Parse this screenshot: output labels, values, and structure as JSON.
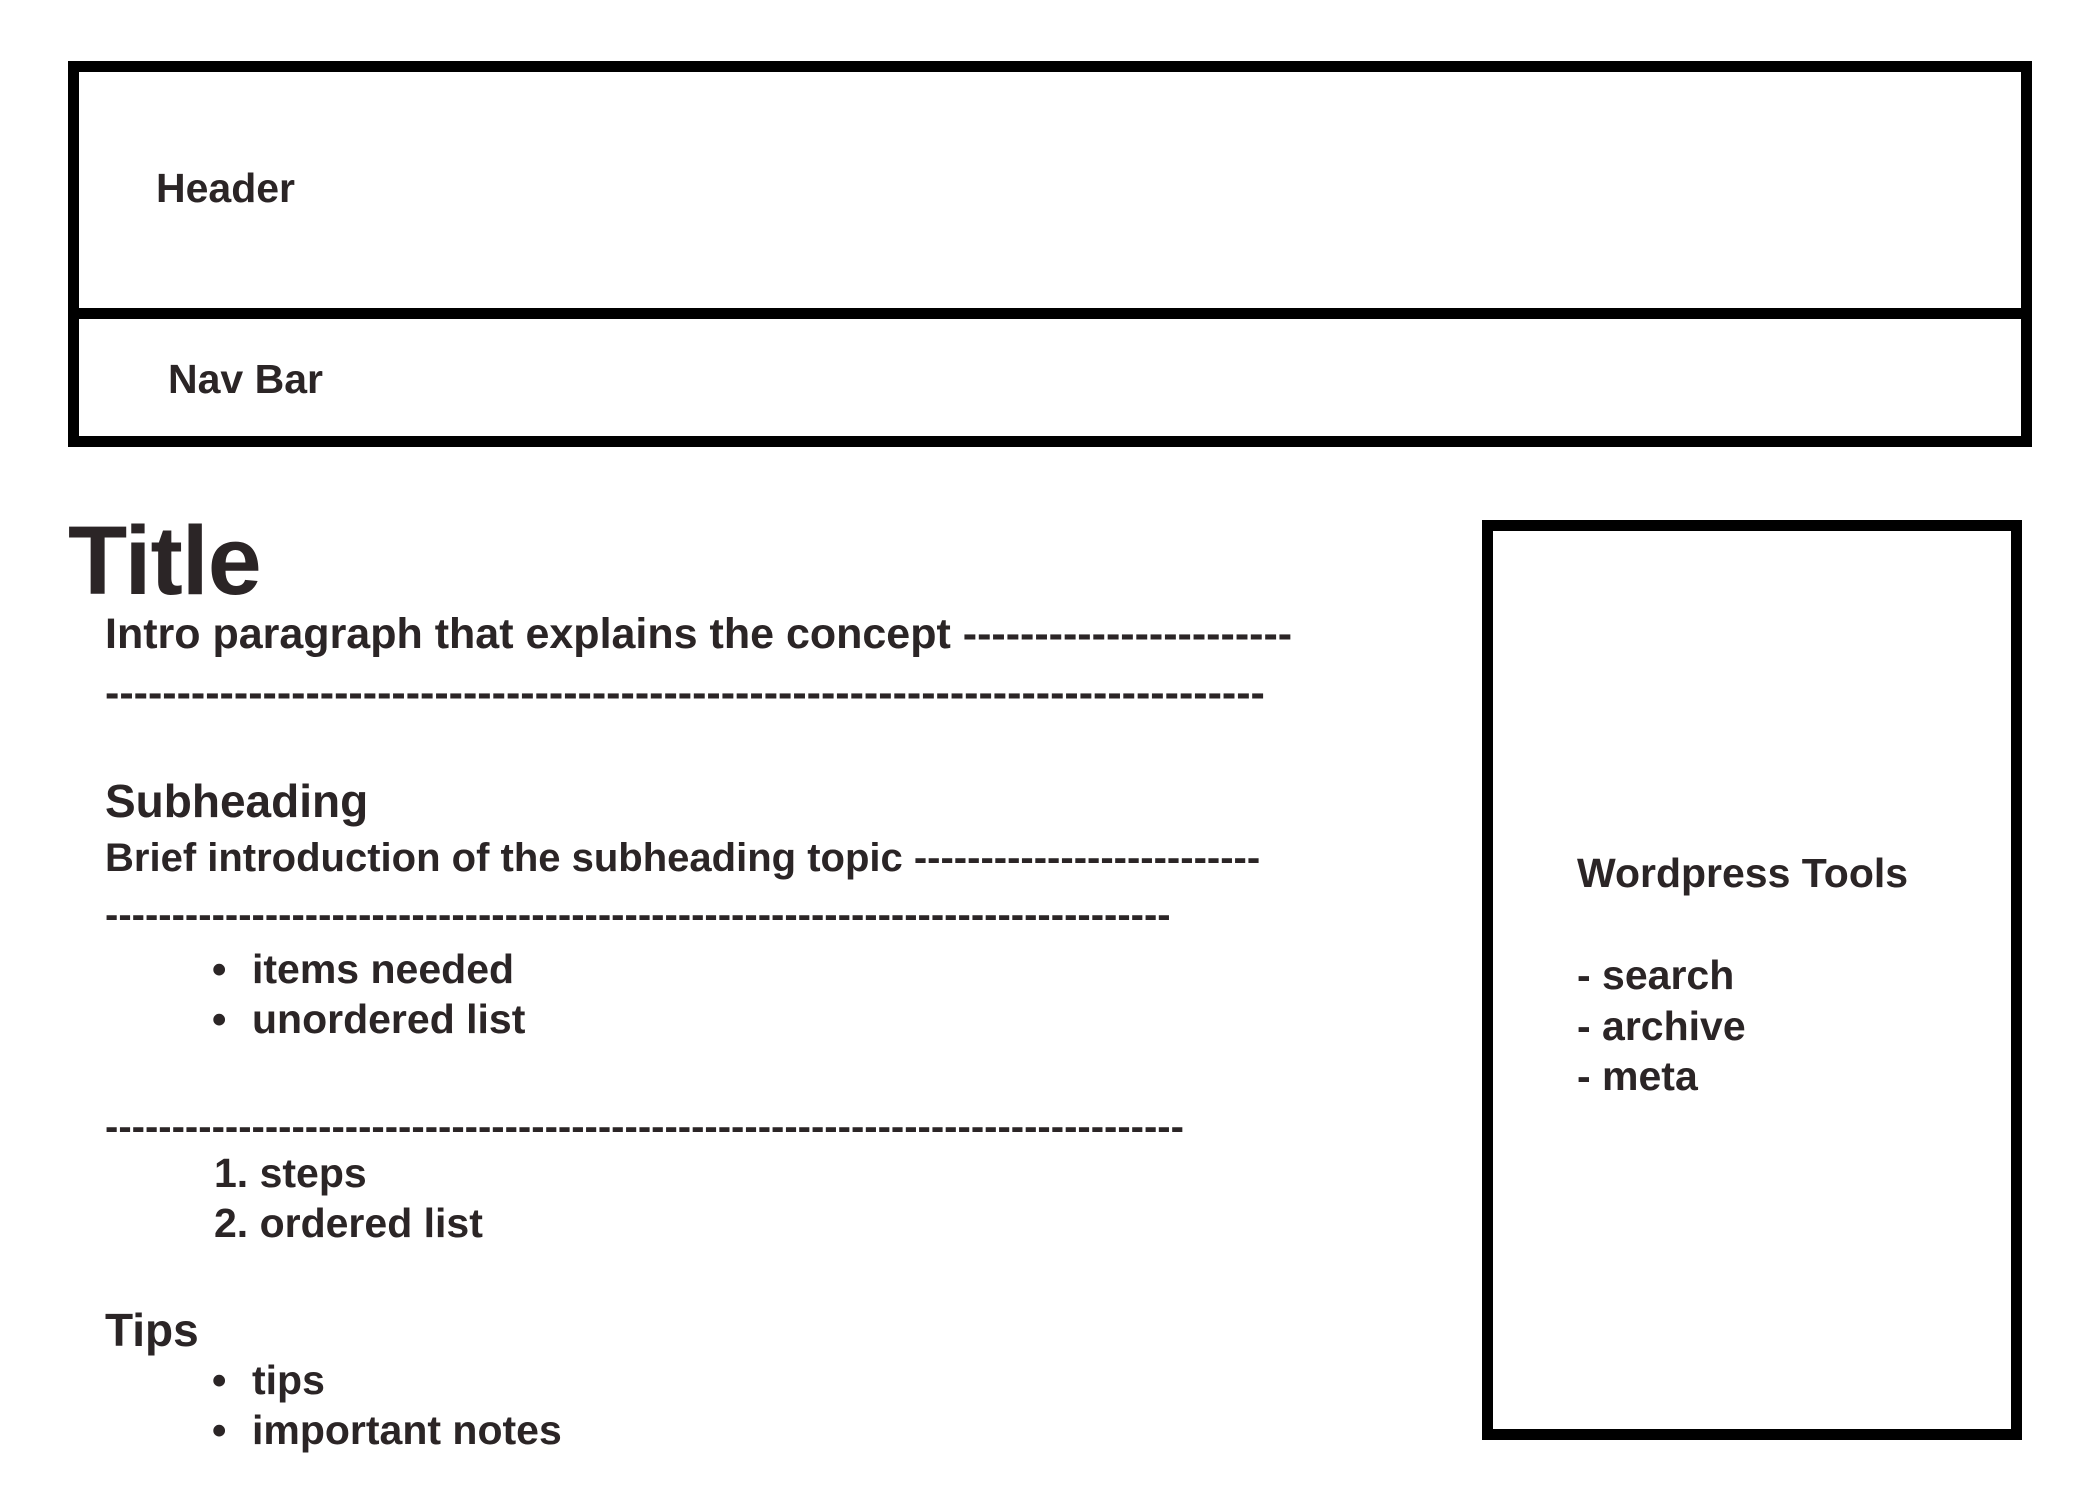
{
  "header": {
    "label": "Header"
  },
  "nav": {
    "label": "Nav Bar"
  },
  "main": {
    "title": "Title",
    "intro_lines": [
      "Intro paragraph that explains the concept -----------------------",
      "---------------------------------------------------------------------------------"
    ],
    "subheading": "Subheading",
    "sub_intro_lines": [
      "Brief introduction of the subheading topic --------------------------",
      "--------------------------------------------------------------------------------"
    ],
    "unordered_list": [
      "items needed",
      "unordered list"
    ],
    "divider": "---------------------------------------------------------------------------------",
    "ordered_list": [
      "1. steps",
      "2. ordered list"
    ],
    "tips": {
      "heading": "Tips",
      "items": [
        "tips",
        "important notes"
      ]
    }
  },
  "sidebar": {
    "title": "Wordpress Tools",
    "items": [
      "- search",
      "- archive",
      "- meta"
    ]
  }
}
